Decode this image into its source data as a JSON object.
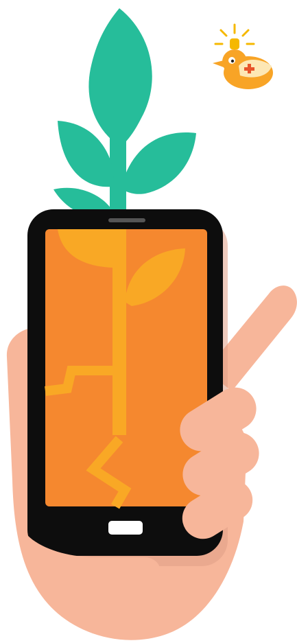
{
  "illustration": {
    "subject": "hand-holding-cracked-phone-with-sprout",
    "colors": {
      "background": "#ffffff",
      "leaf": "#26bd9a",
      "skin": "#f7b69a",
      "skin_shadow": "#e09f86",
      "phone_body": "#0d0d0d",
      "screen": "#f5882f",
      "screen_overlay": "#f9a825",
      "crack": "#f9a825",
      "home_button": "#ffffff",
      "speaker": "#555555",
      "bird_body": "#f8a426",
      "bird_cap": "#fde7b5",
      "bird_cross": "#e8532a",
      "siren": "#f5b800",
      "siren_rays": "#f5b800",
      "eye": "#ffffff",
      "pupil": "#222222"
    },
    "icons": {
      "plant": "sprout-icon",
      "bird": "medic-bird-icon",
      "phone": "smartphone-icon",
      "hand": "hand-icon"
    }
  }
}
